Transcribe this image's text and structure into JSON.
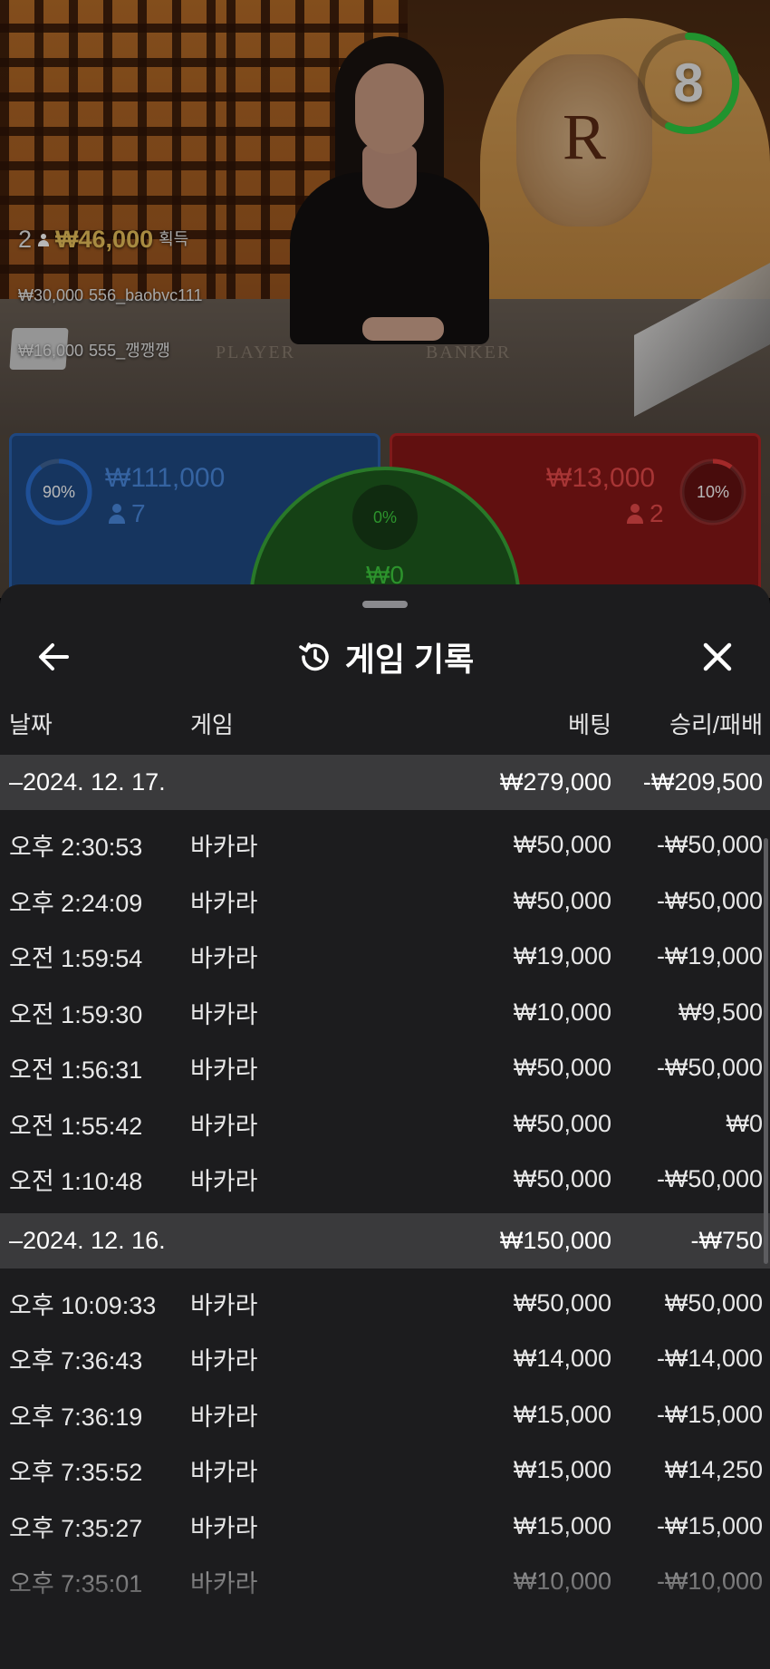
{
  "live": {
    "timer": "8",
    "felt": {
      "player": "PLAYER",
      "banker": "BANKER"
    },
    "crest_letter": "R",
    "ticker": {
      "top_count": "2",
      "top_amount": "₩46,000",
      "top_suffix": "획득",
      "entries": [
        {
          "amount": "₩30,000",
          "user": "556_baobvc111"
        },
        {
          "amount": "₩16,000",
          "user": "555_깽깽깽"
        }
      ]
    },
    "board": {
      "player": {
        "percent": "90%",
        "amount": "₩111,000",
        "players": "7",
        "fill": 0.9,
        "color": "#2b6fd1"
      },
      "banker": {
        "percent": "10%",
        "amount": "₩13,000",
        "players": "2",
        "fill": 0.1,
        "color": "#e23a3a"
      },
      "tie": {
        "percent": "0%",
        "amount": "₩0",
        "color": "#3ecc3e"
      }
    }
  },
  "history": {
    "title": "게임 기록",
    "columns": {
      "date": "날짜",
      "game": "게임",
      "bet": "베팅",
      "result": "승리/패배"
    },
    "groups": [
      {
        "date": "–2024. 12. 17.",
        "bet": "₩279,000",
        "result": "-₩209,500",
        "rows": [
          {
            "time": "오후 2:30:53",
            "game": "바카라",
            "bet": "₩50,000",
            "result": "-₩50,000"
          },
          {
            "time": "오후 2:24:09",
            "game": "바카라",
            "bet": "₩50,000",
            "result": "-₩50,000"
          },
          {
            "time": "오전 1:59:54",
            "game": "바카라",
            "bet": "₩19,000",
            "result": "-₩19,000"
          },
          {
            "time": "오전 1:59:30",
            "game": "바카라",
            "bet": "₩10,000",
            "result": "₩9,500"
          },
          {
            "time": "오전 1:56:31",
            "game": "바카라",
            "bet": "₩50,000",
            "result": "-₩50,000"
          },
          {
            "time": "오전 1:55:42",
            "game": "바카라",
            "bet": "₩50,000",
            "result": "₩0"
          },
          {
            "time": "오전 1:10:48",
            "game": "바카라",
            "bet": "₩50,000",
            "result": "-₩50,000"
          }
        ]
      },
      {
        "date": "–2024. 12. 16.",
        "bet": "₩150,000",
        "result": "-₩750",
        "rows": [
          {
            "time": "오후 10:09:33",
            "game": "바카라",
            "bet": "₩50,000",
            "result": "₩50,000"
          },
          {
            "time": "오후 7:36:43",
            "game": "바카라",
            "bet": "₩14,000",
            "result": "-₩14,000"
          },
          {
            "time": "오후 7:36:19",
            "game": "바카라",
            "bet": "₩15,000",
            "result": "-₩15,000"
          },
          {
            "time": "오후 7:35:52",
            "game": "바카라",
            "bet": "₩15,000",
            "result": "₩14,250"
          },
          {
            "time": "오후 7:35:27",
            "game": "바카라",
            "bet": "₩15,000",
            "result": "-₩15,000"
          },
          {
            "time": "오후 7:35:01",
            "game": "바카라",
            "bet": "₩10,000",
            "result": "-₩10,000"
          }
        ]
      }
    ]
  }
}
